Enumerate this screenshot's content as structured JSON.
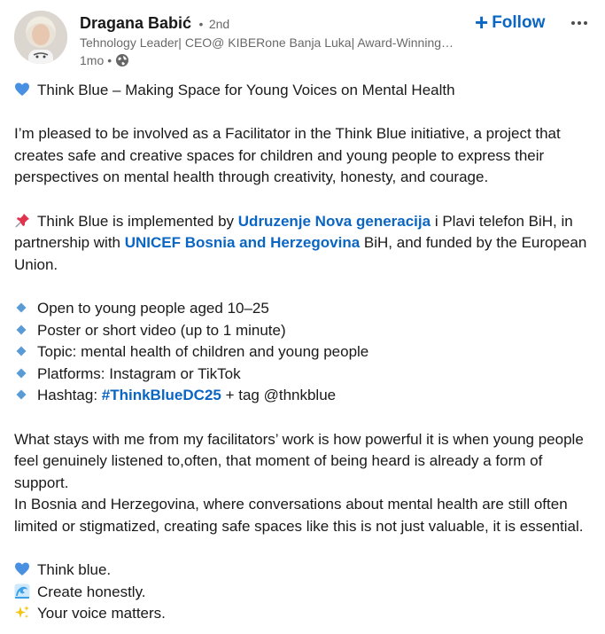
{
  "author": {
    "name": "Dragana Babić",
    "degree_separator": "•",
    "degree": "2nd",
    "headline": "Tehnology Leader| CEO@ KIBERone Banja Luka| Award-Winning…",
    "time": "1mo",
    "meta_separator": "•",
    "visibility_icon": "globe-icon"
  },
  "actions": {
    "follow_icon": "+",
    "follow_label": "Follow",
    "more_icon": "ellipsis-icon"
  },
  "post": {
    "title": "Think Blue – Making Space for Young Voices on Mental Health",
    "intro": "I’m pleased to be involved as a Facilitator in the Think Blue initiative, a project that creates safe and creative spaces for children and young people to express their perspectives on mental health through creativity, honesty, and courage.",
    "partners_1": "Think Blue is implemented by ",
    "mention_1": "Udruzenje Nova generacija",
    "partners_2": " i Plavi telefon BiH, in partnership with ",
    "mention_2": "UNICEF Bosnia and Herzegovina",
    "partners_3": " BiH, and funded by the European Union.",
    "bullets": [
      "Open to young people aged 10–25",
      "Poster or short video (up to 1 minute)",
      "Topic: mental health of children and young people",
      "Platforms: Instagram or TikTok"
    ],
    "hashtag_prefix": "Hashtag: ",
    "hashtag": "#ThinkBlueDC25",
    "hashtag_suffix": " + tag @thnkblue",
    "reflection": "What stays with me from my facilitators’ work is how powerful it is when young people feel genuinely listened to,often, that moment of being heard is already a form of support.",
    "context": "In Bosnia and Herzegovina, where conversations about mental health are still often limited or stigmatized, creating safe spaces like this is not just valuable, it is essential.",
    "closing": [
      "Think blue.",
      "Create honestly.",
      "Your voice matters."
    ]
  },
  "colors": {
    "link_blue": "#0a66c2",
    "heart_blue": "#4a90e2",
    "pin_red": "#e0334d",
    "diamond_blue": "#5b9bd5",
    "wave_blue": "#3aa0e8",
    "sparkle_yellow": "#f5c518"
  },
  "emoji_names": {
    "title": "blue-heart-icon",
    "partners": "pushpin-icon",
    "bullet": "small-blue-diamond-icon",
    "closing": [
      "blue-heart-icon",
      "wave-icon",
      "sparkles-icon"
    ]
  }
}
